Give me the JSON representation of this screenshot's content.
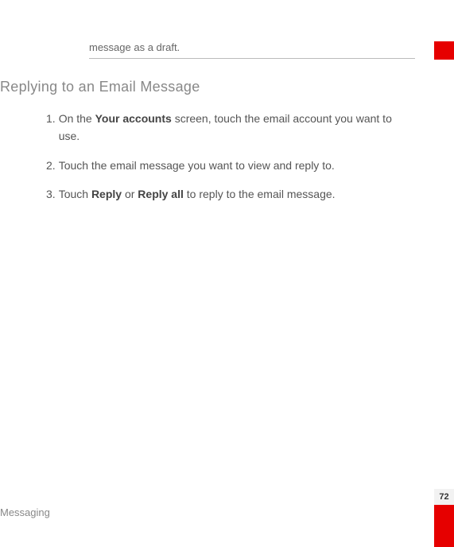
{
  "draft_fragment": "message as a draft.",
  "section_heading": "Replying to an Email Message",
  "steps": [
    {
      "num": "1.",
      "pre": "On the ",
      "b1": "Your accounts",
      "mid": " screen, touch the email account you want to use.",
      "b2": "",
      "post": ""
    },
    {
      "num": "2.",
      "pre": "Touch the email message you want to view and reply to.",
      "b1": "",
      "mid": "",
      "b2": "",
      "post": ""
    },
    {
      "num": "3.",
      "pre": "Touch ",
      "b1": "Reply",
      "mid": " or ",
      "b2": "Reply all",
      "post": " to reply to the email message."
    }
  ],
  "footer_label": "Messaging",
  "page_number": "72"
}
